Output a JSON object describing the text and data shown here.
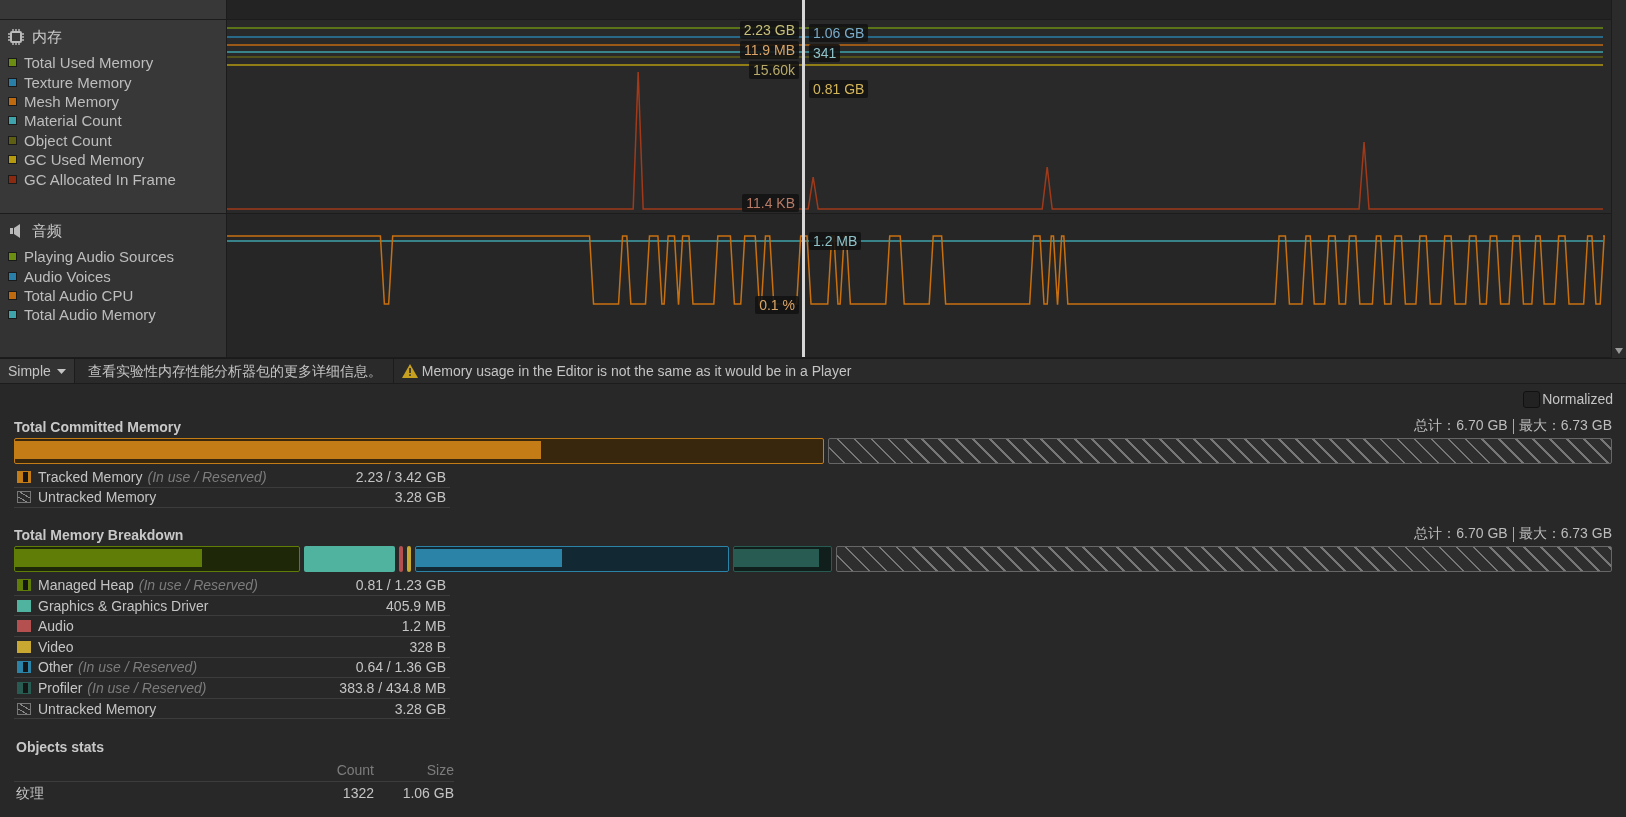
{
  "modules": [
    {
      "kind": "memory",
      "title": "内存",
      "series": [
        {
          "name": "Total Used Memory",
          "color": "#6b8e12"
        },
        {
          "name": "Texture Memory",
          "color": "#2a7fa8"
        },
        {
          "name": "Mesh Memory",
          "color": "#c06a10"
        },
        {
          "name": "Material Count",
          "color": "#3fa3ab"
        },
        {
          "name": "Object Count",
          "color": "#5f5f14"
        },
        {
          "name": "GC Used Memory",
          "color": "#b59a10"
        },
        {
          "name": "GC Allocated In Frame",
          "color": "#8a2a10"
        }
      ],
      "labels_left": [
        {
          "text": "2.23 GB",
          "color": "#c8c07a"
        },
        {
          "text": "11.9 MB",
          "color": "#d8a468"
        },
        {
          "text": "15.60k",
          "color": "#b8aa6a"
        },
        {
          "text": "11.4 KB",
          "color": "#b87a66"
        }
      ],
      "labels_right": [
        {
          "text": "1.06 GB",
          "color": "#79aac8"
        },
        {
          "text": "341",
          "color": "#8fc2c8"
        },
        {
          "text": "0.81 GB",
          "color": "#d4b65a"
        }
      ]
    },
    {
      "kind": "audio",
      "title": "音频",
      "series": [
        {
          "name": "Playing Audio Sources",
          "color": "#6b8e12"
        },
        {
          "name": "Audio Voices",
          "color": "#2a7fa8"
        },
        {
          "name": "Total Audio CPU",
          "color": "#c06a10"
        },
        {
          "name": "Total Audio Memory",
          "color": "#3fa3ab"
        }
      ],
      "labels_left": [
        {
          "text": "0.1 %",
          "color": "#d8a468"
        }
      ],
      "labels_right": [
        {
          "text": "1.2 MB",
          "color": "#8fc2c8"
        }
      ]
    }
  ],
  "toolbar": {
    "mode": "Simple",
    "link": "查看实验性内存性能分析器包的更多详细信息。",
    "warning": "Memory usage in the Editor is not the same as it would be in a Player"
  },
  "normalized": {
    "label": "Normalized",
    "checked": false
  },
  "sections": [
    {
      "title": "Total Committed Memory",
      "total": "总计：6.70 GB",
      "max": "最大：6.73 GB",
      "rows": [
        {
          "kind": "split",
          "label": "Tracked Memory",
          "note": "(In use / Reserved)",
          "value": "2.23 / 3.42 GB",
          "color": "#c47d16",
          "level": 0.65
        },
        {
          "kind": "hatched",
          "label": "Untracked Memory",
          "value": "3.28 GB"
        }
      ]
    },
    {
      "title": "Total Memory Breakdown",
      "total": "总计：6.70 GB",
      "max": "最大：6.73 GB",
      "rows": [
        {
          "kind": "split",
          "label": "Managed Heap",
          "note": "(In use / Reserved)",
          "value": "0.81 / 1.23 GB",
          "color": "#5f7d07",
          "level": 0.66
        },
        {
          "kind": "solid",
          "label": "Graphics & Graphics Driver",
          "value": "405.9 MB",
          "color": "#4fb3a0"
        },
        {
          "kind": "solid",
          "label": "Audio",
          "value": "1.2 MB",
          "color": "#b55050"
        },
        {
          "kind": "solid",
          "label": "Video",
          "value": "328 B",
          "color": "#c8a830"
        },
        {
          "kind": "split",
          "label": "Other",
          "note": "(In use / Reserved)",
          "value": "0.64 / 1.36 GB",
          "color": "#2b83a8",
          "level": 0.47
        },
        {
          "kind": "split",
          "label": "Profiler",
          "note": "(In use / Reserved)",
          "value": "383.8 / 434.8 MB",
          "color": "#285c52",
          "level": 0.88
        },
        {
          "kind": "hatched",
          "label": "Untracked Memory",
          "value": "3.28 GB"
        }
      ]
    }
  ],
  "objects_stats": {
    "title": "Objects stats",
    "columns": [
      "Count",
      "Size"
    ],
    "rows": [
      {
        "name": "纹理",
        "count": "1322",
        "size": "1.06 GB"
      }
    ]
  }
}
